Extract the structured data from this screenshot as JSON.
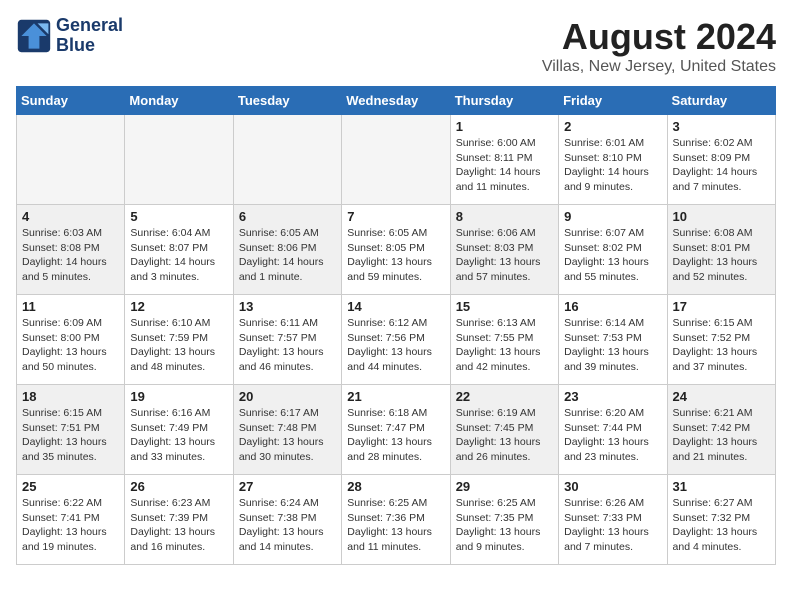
{
  "header": {
    "logo_line1": "General",
    "logo_line2": "Blue",
    "month": "August 2024",
    "location": "Villas, New Jersey, United States"
  },
  "weekdays": [
    "Sunday",
    "Monday",
    "Tuesday",
    "Wednesday",
    "Thursday",
    "Friday",
    "Saturday"
  ],
  "weeks": [
    [
      {
        "day": "",
        "empty": true
      },
      {
        "day": "",
        "empty": true
      },
      {
        "day": "",
        "empty": true
      },
      {
        "day": "",
        "empty": true
      },
      {
        "day": "1",
        "sunrise": "6:00 AM",
        "sunset": "8:11 PM",
        "daylight": "14 hours and 11 minutes."
      },
      {
        "day": "2",
        "sunrise": "6:01 AM",
        "sunset": "8:10 PM",
        "daylight": "14 hours and 9 minutes."
      },
      {
        "day": "3",
        "sunrise": "6:02 AM",
        "sunset": "8:09 PM",
        "daylight": "14 hours and 7 minutes."
      }
    ],
    [
      {
        "day": "4",
        "sunrise": "6:03 AM",
        "sunset": "8:08 PM",
        "daylight": "14 hours and 5 minutes."
      },
      {
        "day": "5",
        "sunrise": "6:04 AM",
        "sunset": "8:07 PM",
        "daylight": "14 hours and 3 minutes."
      },
      {
        "day": "6",
        "sunrise": "6:05 AM",
        "sunset": "8:06 PM",
        "daylight": "14 hours and 1 minute."
      },
      {
        "day": "7",
        "sunrise": "6:05 AM",
        "sunset": "8:05 PM",
        "daylight": "13 hours and 59 minutes."
      },
      {
        "day": "8",
        "sunrise": "6:06 AM",
        "sunset": "8:03 PM",
        "daylight": "13 hours and 57 minutes."
      },
      {
        "day": "9",
        "sunrise": "6:07 AM",
        "sunset": "8:02 PM",
        "daylight": "13 hours and 55 minutes."
      },
      {
        "day": "10",
        "sunrise": "6:08 AM",
        "sunset": "8:01 PM",
        "daylight": "13 hours and 52 minutes."
      }
    ],
    [
      {
        "day": "11",
        "sunrise": "6:09 AM",
        "sunset": "8:00 PM",
        "daylight": "13 hours and 50 minutes."
      },
      {
        "day": "12",
        "sunrise": "6:10 AM",
        "sunset": "7:59 PM",
        "daylight": "13 hours and 48 minutes."
      },
      {
        "day": "13",
        "sunrise": "6:11 AM",
        "sunset": "7:57 PM",
        "daylight": "13 hours and 46 minutes."
      },
      {
        "day": "14",
        "sunrise": "6:12 AM",
        "sunset": "7:56 PM",
        "daylight": "13 hours and 44 minutes."
      },
      {
        "day": "15",
        "sunrise": "6:13 AM",
        "sunset": "7:55 PM",
        "daylight": "13 hours and 42 minutes."
      },
      {
        "day": "16",
        "sunrise": "6:14 AM",
        "sunset": "7:53 PM",
        "daylight": "13 hours and 39 minutes."
      },
      {
        "day": "17",
        "sunrise": "6:15 AM",
        "sunset": "7:52 PM",
        "daylight": "13 hours and 37 minutes."
      }
    ],
    [
      {
        "day": "18",
        "sunrise": "6:15 AM",
        "sunset": "7:51 PM",
        "daylight": "13 hours and 35 minutes."
      },
      {
        "day": "19",
        "sunrise": "6:16 AM",
        "sunset": "7:49 PM",
        "daylight": "13 hours and 33 minutes."
      },
      {
        "day": "20",
        "sunrise": "6:17 AM",
        "sunset": "7:48 PM",
        "daylight": "13 hours and 30 minutes."
      },
      {
        "day": "21",
        "sunrise": "6:18 AM",
        "sunset": "7:47 PM",
        "daylight": "13 hours and 28 minutes."
      },
      {
        "day": "22",
        "sunrise": "6:19 AM",
        "sunset": "7:45 PM",
        "daylight": "13 hours and 26 minutes."
      },
      {
        "day": "23",
        "sunrise": "6:20 AM",
        "sunset": "7:44 PM",
        "daylight": "13 hours and 23 minutes."
      },
      {
        "day": "24",
        "sunrise": "6:21 AM",
        "sunset": "7:42 PM",
        "daylight": "13 hours and 21 minutes."
      }
    ],
    [
      {
        "day": "25",
        "sunrise": "6:22 AM",
        "sunset": "7:41 PM",
        "daylight": "13 hours and 19 minutes."
      },
      {
        "day": "26",
        "sunrise": "6:23 AM",
        "sunset": "7:39 PM",
        "daylight": "13 hours and 16 minutes."
      },
      {
        "day": "27",
        "sunrise": "6:24 AM",
        "sunset": "7:38 PM",
        "daylight": "13 hours and 14 minutes."
      },
      {
        "day": "28",
        "sunrise": "6:25 AM",
        "sunset": "7:36 PM",
        "daylight": "13 hours and 11 minutes."
      },
      {
        "day": "29",
        "sunrise": "6:25 AM",
        "sunset": "7:35 PM",
        "daylight": "13 hours and 9 minutes."
      },
      {
        "day": "30",
        "sunrise": "6:26 AM",
        "sunset": "7:33 PM",
        "daylight": "13 hours and 7 minutes."
      },
      {
        "day": "31",
        "sunrise": "6:27 AM",
        "sunset": "7:32 PM",
        "daylight": "13 hours and 4 minutes."
      }
    ]
  ]
}
